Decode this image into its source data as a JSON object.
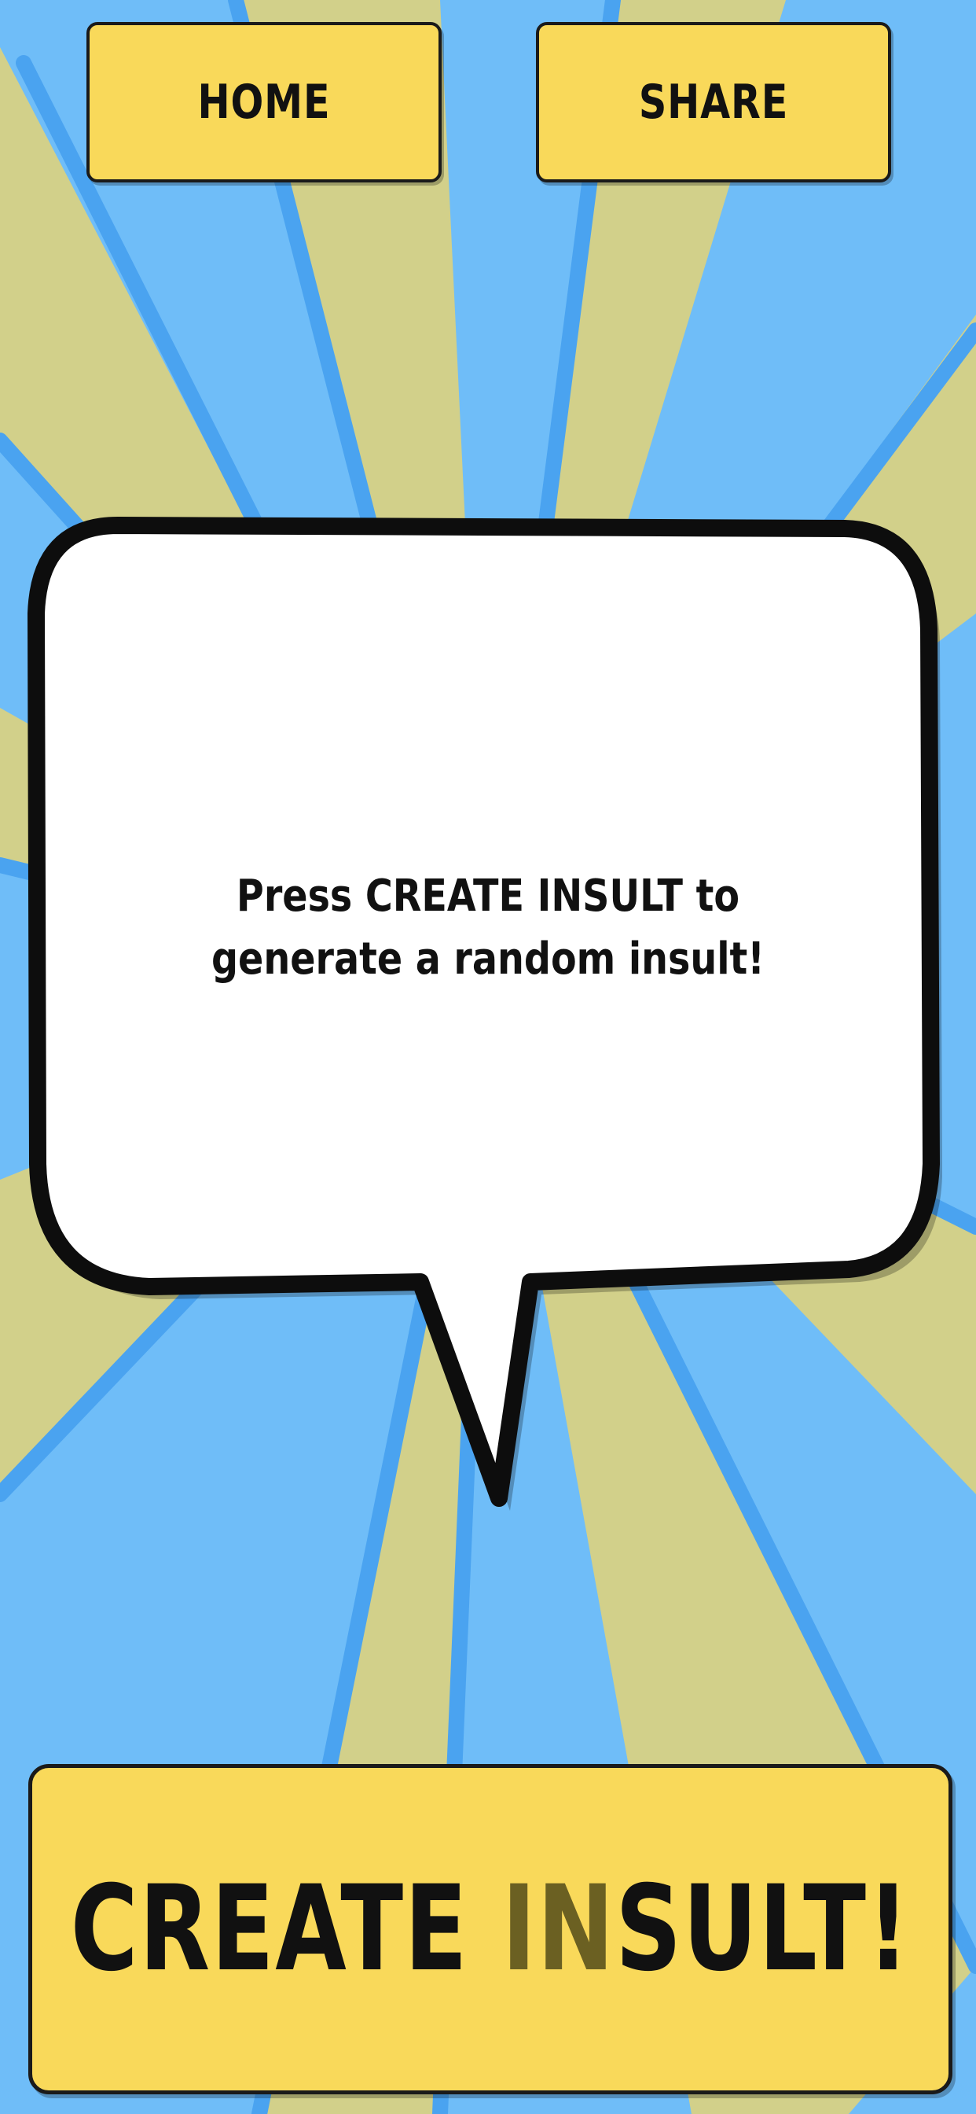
{
  "nav": {
    "home_label": "HOME",
    "share_label": "SHARE"
  },
  "bubble": {
    "message": "Press CREATE INSULT to generate a random insult!"
  },
  "create": {
    "part1": "CREATE ",
    "part2": "IN",
    "part3": "SULT!"
  },
  "colors": {
    "sky_blue": "#6fbdf8",
    "ray_khaki": "#d2d08a",
    "ray_stripe": "#4aa3f0",
    "button_yellow": "#f9d95a",
    "outline": "#1a1a1a"
  }
}
